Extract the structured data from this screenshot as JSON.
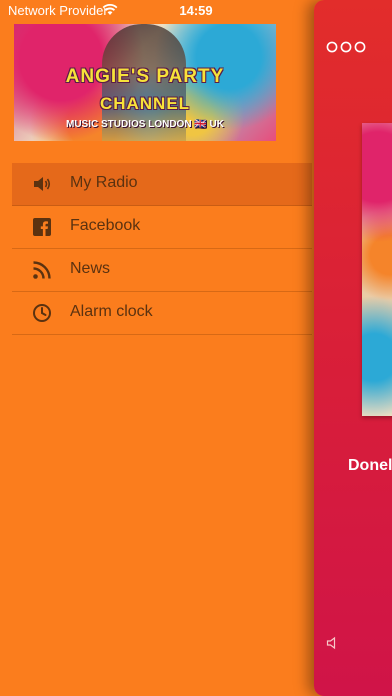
{
  "status_bar": {
    "carrier": "Network Provider",
    "time": "14:59"
  },
  "banner": {
    "title_line1": "ANGIE'S PARTY",
    "title_line2": "CHANNEL",
    "subtitle": "MUSIC STUDIOS LONDON 🇬🇧 UK"
  },
  "menu": {
    "items": [
      {
        "label": "My Radio",
        "icon": "speaker-icon",
        "active": true
      },
      {
        "label": "Facebook",
        "icon": "facebook-icon",
        "active": false
      },
      {
        "label": "News",
        "icon": "rss-icon",
        "active": false
      },
      {
        "label": "Alarm clock",
        "icon": "clock-icon",
        "active": false
      }
    ]
  },
  "player": {
    "track_title": "Donel",
    "more_icon": "more-icon",
    "volume_icon": "volume-icon"
  },
  "colors": {
    "background": "#fb7d1d",
    "active_item": "#e5691a",
    "panel_top": "#e22d2b",
    "panel_bottom": "#d01448",
    "menu_text": "#5b3210"
  }
}
